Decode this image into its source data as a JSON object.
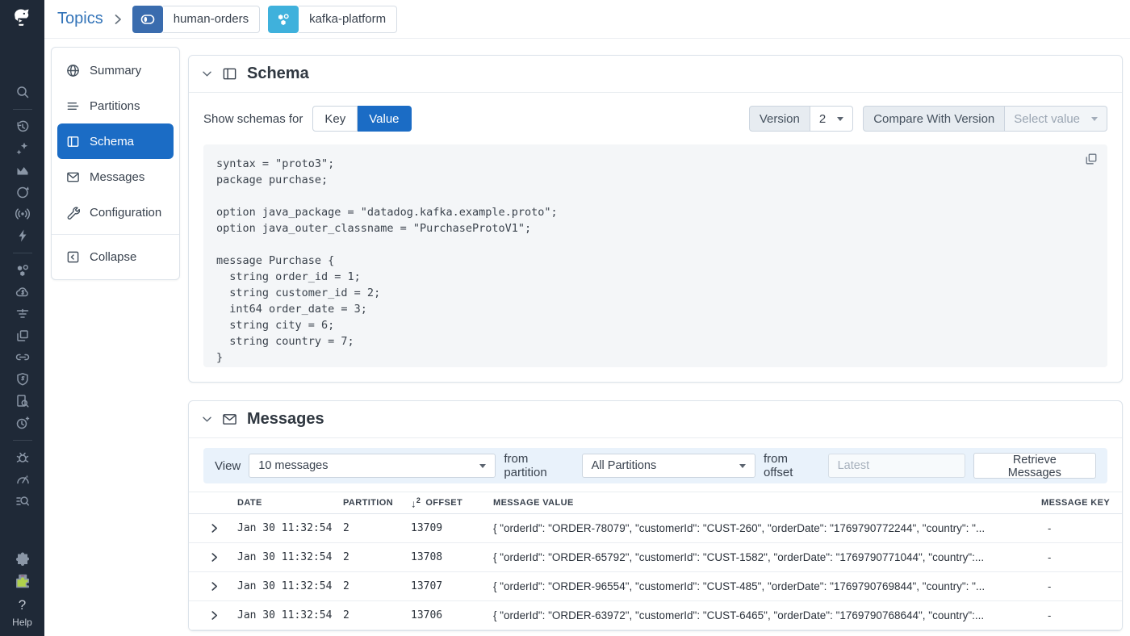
{
  "colors": {
    "accent_blue": "#1b6cc5",
    "link_blue": "#3273b8",
    "topic_badge_blue": "#3a6cae",
    "cluster_badge_blue": "#3fb1dc",
    "sidebar_bg": "#1f2937",
    "toolbar_bg": "#e9f2fb",
    "code_bg": "#f4f6f8",
    "marketplace_green": "#b0d14c"
  },
  "header": {
    "breadcrumb_root": "Topics",
    "topic_name": "human-orders",
    "cluster_name": "kafka-platform"
  },
  "sidebar": {
    "icon_names": [
      "datadog-logo",
      "search",
      "history",
      "copilot-sparkles",
      "metrics",
      "apm",
      "live-tail",
      "events",
      "data-streams",
      "cloud-cost",
      "log-pipelines",
      "software-catalog",
      "service-links",
      "security",
      "audit-trail",
      "monitors",
      "error-tracking",
      "profiling",
      "log-explorer",
      "integrations",
      "marketplace"
    ],
    "help_icon": "?",
    "help_label": "Help"
  },
  "nav": {
    "items": [
      {
        "label": "Summary",
        "icon": "globe"
      },
      {
        "label": "Partitions",
        "icon": "partitions"
      },
      {
        "label": "Schema",
        "icon": "table",
        "active": true
      },
      {
        "label": "Messages",
        "icon": "envelope"
      },
      {
        "label": "Configuration",
        "icon": "wrench"
      }
    ],
    "collapse_label": "Collapse"
  },
  "schema_panel": {
    "title": "Schema",
    "show_schemas_for_label": "Show schemas for",
    "key_label": "Key",
    "value_label": "Value",
    "selected_toggle": "Value",
    "version_label": "Version",
    "version_value": "2",
    "compare_label": "Compare With Version",
    "compare_placeholder": "Select value",
    "code": "syntax = \"proto3\";\npackage purchase;\n\noption java_package = \"datadog.kafka.example.proto\";\noption java_outer_classname = \"PurchaseProtoV1\";\n\nmessage Purchase {\n  string order_id = 1;\n  string customer_id = 2;\n  int64 order_date = 3;\n  string city = 6;\n  string country = 7;\n}"
  },
  "messages_panel": {
    "title": "Messages",
    "toolbar": {
      "view_label": "View",
      "view_value": "10 messages",
      "from_partition_label": "from partition",
      "partition_value": "All Partitions",
      "from_offset_label": "from offset",
      "offset_placeholder": "Latest",
      "retrieve_button": "Retrieve Messages"
    },
    "table": {
      "columns": {
        "date": "DATE",
        "partition": "PARTITION",
        "offset": "OFFSET",
        "value": "MESSAGE VALUE",
        "key": "MESSAGE KEY"
      },
      "sort_arrow": "↓",
      "sort_order": "2",
      "rows": [
        {
          "date": "Jan 30 11:32:54",
          "partition": "2",
          "offset": "13709",
          "value": "{ \"orderId\": \"ORDER-78079\", \"customerId\": \"CUST-260\", \"orderDate\": \"1769790772244\", \"country\": \"...",
          "key": "-"
        },
        {
          "date": "Jan 30 11:32:54",
          "partition": "2",
          "offset": "13708",
          "value": "{ \"orderId\": \"ORDER-65792\", \"customerId\": \"CUST-1582\", \"orderDate\": \"1769790771044\", \"country\":...",
          "key": "-"
        },
        {
          "date": "Jan 30 11:32:54",
          "partition": "2",
          "offset": "13707",
          "value": "{ \"orderId\": \"ORDER-96554\", \"customerId\": \"CUST-485\", \"orderDate\": \"1769790769844\", \"country\": \"...",
          "key": "-"
        },
        {
          "date": "Jan 30 11:32:54",
          "partition": "2",
          "offset": "13706",
          "value": "{ \"orderId\": \"ORDER-63972\", \"customerId\": \"CUST-6465\", \"orderDate\": \"1769790768644\", \"country\":...",
          "key": "-"
        }
      ]
    }
  }
}
